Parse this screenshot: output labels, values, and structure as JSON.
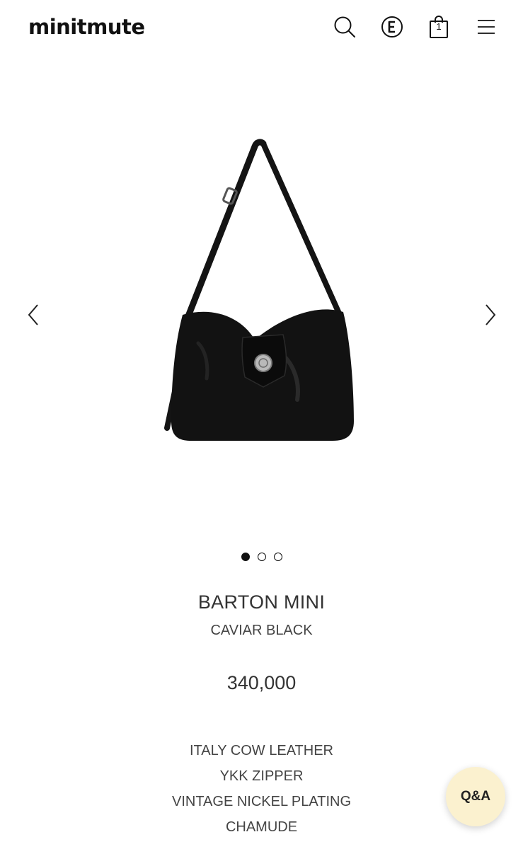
{
  "header": {
    "logo": "minitmute",
    "cart_count": "1"
  },
  "icons": {
    "search": "search-icon",
    "coupon": "coupon-e-icon",
    "cart": "shopping-bag-icon",
    "menu": "hamburger-menu-icon",
    "prev": "chevron-left-icon",
    "next": "chevron-right-icon"
  },
  "gallery": {
    "slide_count": 3,
    "active_index": 0
  },
  "product": {
    "name": "BARTON MINI",
    "color": "CAVIAR BLACK",
    "price": "340,000",
    "features": [
      "ITALY COW LEATHER",
      "YKK ZIPPER",
      "VINTAGE NICKEL PLATING",
      "CHAMUDE"
    ]
  },
  "qa_button": {
    "label": "Q&A",
    "background": "#fbf1cf"
  }
}
